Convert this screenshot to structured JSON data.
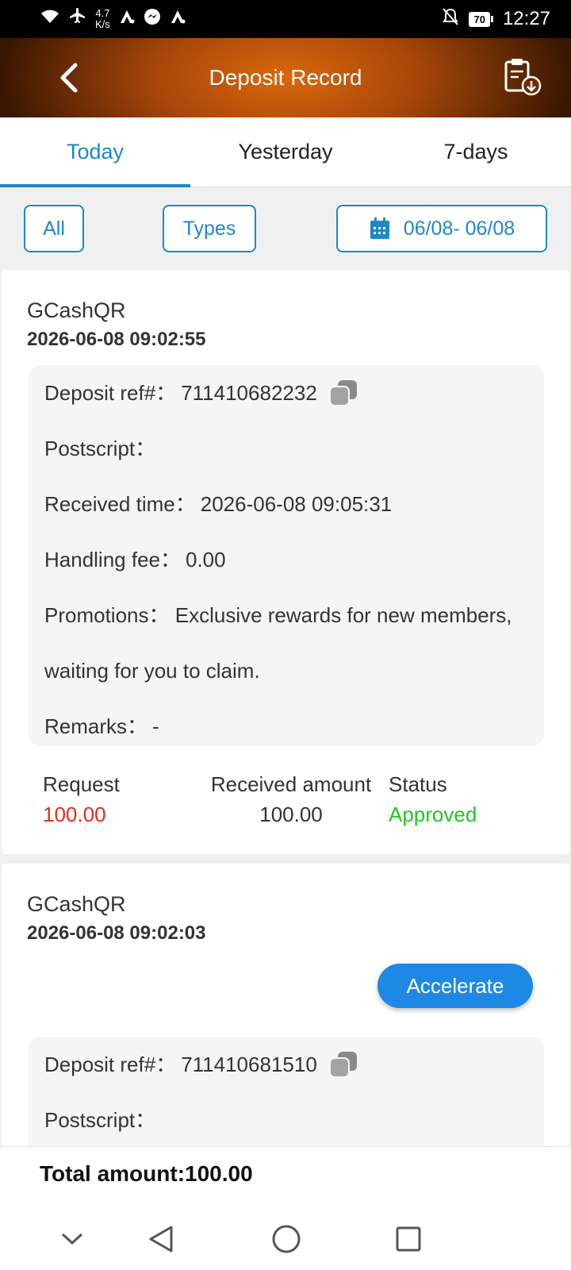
{
  "status_bar": {
    "net_speed_value": "4.7",
    "net_speed_unit": "K/s",
    "battery": "70",
    "time": "12:27"
  },
  "header": {
    "title": "Deposit Record"
  },
  "tabs": [
    {
      "label": "Today",
      "active": true
    },
    {
      "label": "Yesterday",
      "active": false
    },
    {
      "label": "7-days",
      "active": false
    }
  ],
  "filters": {
    "all_label": "All",
    "types_label": "Types",
    "date_range": "06/08- 06/08"
  },
  "records": [
    {
      "method": "GCashQR",
      "datetime": "2026-06-08 09:02:55",
      "ref_label": "Deposit ref#：",
      "ref_value": "711410682232",
      "postscript_label": "Postscript：",
      "received_time_label": "Received time：",
      "received_time_value": "2026-06-08 09:05:31",
      "handling_fee_label": "Handling fee：",
      "handling_fee_value": "0.00",
      "promotions_label": "Promotions：",
      "promotions_value": "Exclusive rewards for new members, waiting for you to claim.",
      "remarks_label": "Remarks：",
      "remarks_value": "-",
      "request_label": "Request",
      "request_value": "100.00",
      "received_amount_label": "Received amount",
      "received_amount_value": "100.00",
      "status_label": "Status",
      "status_value": "Approved"
    },
    {
      "method": "GCashQR",
      "datetime": "2026-06-08 09:02:03",
      "accelerate_label": "Accelerate",
      "ref_label": "Deposit ref#：",
      "ref_value": "711410681510",
      "postscript_label": "Postscript："
    }
  ],
  "footer": {
    "total": "Total amount:100.00"
  },
  "colors": {
    "accent": "#1e88c8",
    "request_red": "#e52b19",
    "approved_green": "#21c621",
    "accelerate_blue": "#1e88e5"
  }
}
